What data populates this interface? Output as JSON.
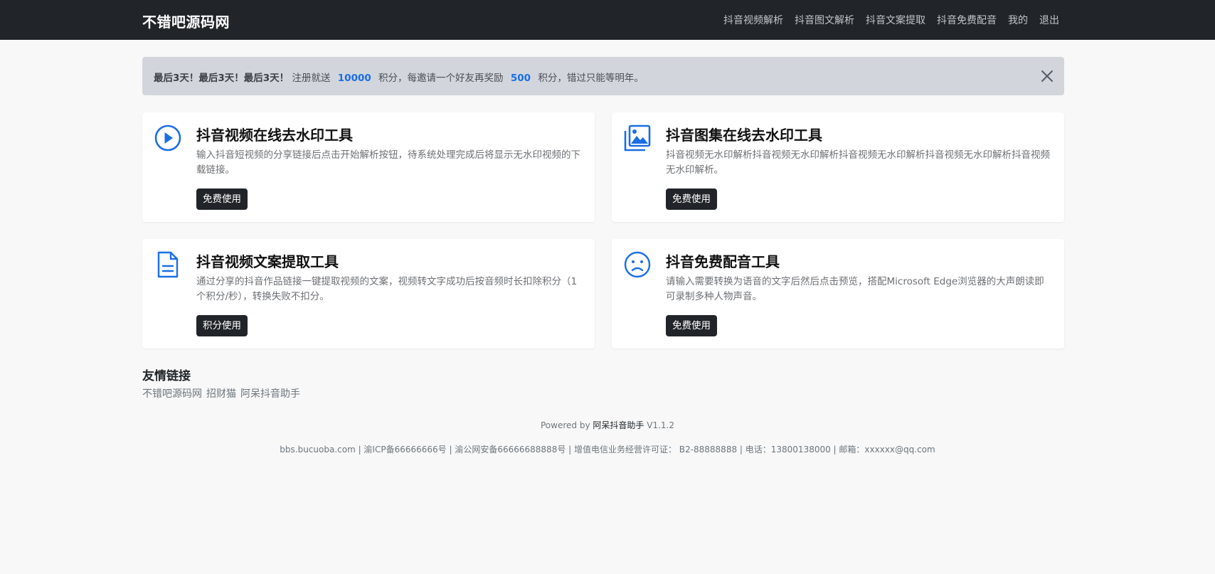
{
  "navbar": {
    "brand": "不错吧源码网",
    "items": [
      "抖音视频解析",
      "抖音图文解析",
      "抖音文案提取",
      "抖音免费配音",
      "我的",
      "退出"
    ]
  },
  "alert": {
    "lead": "最后3天！最后3天！最后3天！",
    "text1": "注册就送",
    "num1": "10000",
    "text2": "积分，每邀请一个好友再奖励",
    "num2": "500",
    "text3": "积分，错过只能等明年。",
    "close_icon": "close-icon"
  },
  "cards": [
    {
      "icon": "play-circle-icon",
      "title": "抖音视频在线去水印工具",
      "desc": "输入抖音短视频的分享链接后点击开始解析按钮，待系统处理完成后将显示无水印视频的下载链接。",
      "button": "免费使用"
    },
    {
      "icon": "images-icon",
      "title": "抖音图集在线去水印工具",
      "desc": "抖音视频无水印解析抖音视频无水印解析抖音视频无水印解析抖音视频无水印解析抖音视频无水印解析。",
      "button": "免费使用"
    },
    {
      "icon": "document-icon",
      "title": "抖音视频文案提取工具",
      "desc": "通过分享的抖音作品链接一键提取视频的文案，视频转文字成功后按音频时长扣除积分（1个积分/秒），转换失败不扣分。",
      "button": "积分使用"
    },
    {
      "icon": "frown-face-icon",
      "title": "抖音免费配音工具",
      "desc": "请输入需要转换为语音的文字后然后点击预览，搭配Microsoft Edge浏览器的大声朗读即可录制多种人物声音。",
      "button": "免费使用"
    }
  ],
  "friend_links": {
    "title": "友情链接",
    "items": [
      "不错吧源码网",
      "招财猫",
      "阿呆抖音助手"
    ]
  },
  "footer": {
    "powered_prefix": "Powered by",
    "powered_name": "阿呆抖音助手",
    "version": "V1.1.2",
    "info": "bbs.bucuoba.com | 渝ICP备66666666号 | 渝公网安备66666688888号 | 增值电信业务经营许可证： B2-88888888 | 电话：13800138000 | 邮箱：xxxxxx@qq.com"
  },
  "colors": {
    "navbar_bg": "#212529",
    "accent": "#1a6ee6",
    "alert_bg": "#d2d6dc"
  }
}
